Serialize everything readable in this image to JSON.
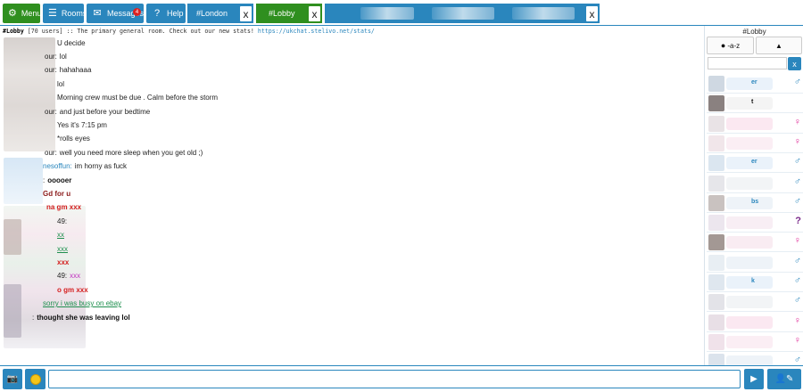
{
  "toolbar": {
    "menu_label": "Menu",
    "rooms_label": "Rooms",
    "messages_label": "Messages",
    "messages_badge": "4",
    "help_label": "Help",
    "icons": {
      "menu": "gear-icon",
      "rooms": "list-icon",
      "messages": "envelope-icon",
      "help": "question-icon"
    }
  },
  "tabs": [
    {
      "label": "#London",
      "close": "x",
      "active": false
    },
    {
      "label": "#Lobby",
      "close": "x",
      "active": true
    },
    {
      "label": "",
      "close": "x",
      "active": false
    }
  ],
  "topic": {
    "room": "#Lobby",
    "users": "[70 users]",
    "text": ":: The primary general room. Check out our new stats!",
    "link": "https://ukchat.stelivo.net/stats/"
  },
  "messages": [
    {
      "name": "",
      "text": "U decide",
      "color": "#222222",
      "bold": false
    },
    {
      "name": "our:",
      "text": "lol",
      "color": "#222222",
      "bold": false
    },
    {
      "name": "our:",
      "text": "hahahaaa",
      "color": "#222222",
      "bold": false
    },
    {
      "name": "",
      "text": "lol",
      "color": "#222222",
      "bold": false
    },
    {
      "name": "",
      "text": "Morning crew must be due . Calm before the storm",
      "color": "#222222",
      "bold": false
    },
    {
      "name": "our:",
      "text": "and just before your bedtime",
      "color": "#222222",
      "bold": false
    },
    {
      "name": "",
      "text": "Yes it's 7:15 pm",
      "color": "#222222",
      "bold": false
    },
    {
      "name": "",
      "text": "*rolls eyes",
      "color": "#222222",
      "bold": false
    },
    {
      "name": "our:",
      "text": "well you need more sleep when you get old ;)",
      "color": "#222222",
      "bold": false
    },
    {
      "name": "nesoffun:",
      "text": "im horny as fuck",
      "color": "#222222",
      "bold": false
    },
    {
      "name": ":",
      "text": "ooooer",
      "color": "#111111",
      "bold": true
    },
    {
      "name": "",
      "text": "Gd for u",
      "color": "#8b1a1a",
      "bold": true
    },
    {
      "name": "",
      "text": "na gm xxx",
      "color": "#d42020",
      "bold": true
    },
    {
      "name": "49:",
      "text": "",
      "color": "#111111",
      "bold": true
    },
    {
      "name": "",
      "text": "xx",
      "color": "#1e8f4e",
      "bold": false
    },
    {
      "name": "",
      "text": "xxx",
      "color": "#1e8f4e",
      "bold": false
    },
    {
      "name": "",
      "text": "xxx",
      "color": "#d42020",
      "bold": true
    },
    {
      "name": "49:",
      "text": "xxx",
      "color": "#c030c0",
      "bold": false
    },
    {
      "name": "",
      "text": "o gm xxx",
      "color": "#d42020",
      "bold": true
    },
    {
      "name": "",
      "text": "sorry i was busy on ebay",
      "color": "#1e8f4e",
      "bold": false
    },
    {
      "name": ":",
      "text": "thought she was leaving lol",
      "color": "#111111",
      "bold": true
    }
  ],
  "panel": {
    "title": "#Lobby",
    "sort_label": "-a-z",
    "sort_dir": "▲",
    "search_placeholder": "",
    "search_clear": "x"
  },
  "users": [
    {
      "name": "er",
      "gender": "♂",
      "g": "m"
    },
    {
      "name": "t",
      "gender": "",
      "g": "m"
    },
    {
      "name": "",
      "gender": "♀",
      "g": "f"
    },
    {
      "name": "",
      "gender": "♀",
      "g": "f"
    },
    {
      "name": "er",
      "gender": "♂",
      "g": "m"
    },
    {
      "name": "",
      "gender": "♂",
      "g": "m"
    },
    {
      "name": "bs",
      "gender": "♂",
      "g": "m"
    },
    {
      "name": "",
      "gender": "?",
      "g": "u"
    },
    {
      "name": "",
      "gender": "♀",
      "g": "f"
    },
    {
      "name": "",
      "gender": "♂",
      "g": "m"
    },
    {
      "name": "k",
      "gender": "♂",
      "g": "m"
    },
    {
      "name": "",
      "gender": "♂",
      "g": "m"
    },
    {
      "name": "",
      "gender": "♀",
      "g": "f"
    },
    {
      "name": "",
      "gender": "♀",
      "g": "f"
    },
    {
      "name": "",
      "gender": "♂",
      "g": "m"
    }
  ],
  "bottom": {
    "input_placeholder": "",
    "icons": {
      "camera": "camera-icon",
      "emoji": "emoji-icon",
      "video": "video-icon",
      "user": "user-edit-icon"
    }
  }
}
